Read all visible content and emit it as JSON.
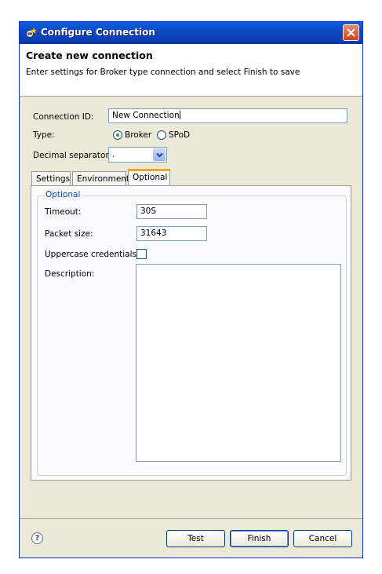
{
  "window": {
    "title": "Configure Connection"
  },
  "header": {
    "title": "Create new connection",
    "description": "Enter settings for Broker type connection and select Finish to save"
  },
  "form": {
    "connection_id_label": "Connection ID:",
    "connection_id_value": "New Connection",
    "type_label": "Type:",
    "type_options": [
      {
        "label": "Broker",
        "selected": true
      },
      {
        "label": "SPoD",
        "selected": false
      }
    ],
    "decimal_label": "Decimal separator:",
    "decimal_value": "."
  },
  "tabs": [
    {
      "label": "Settings",
      "active": false
    },
    {
      "label": "Environment",
      "active": false
    },
    {
      "label": "Optional",
      "active": true
    }
  ],
  "optional": {
    "group_title": "Optional",
    "timeout_label": "Timeout:",
    "timeout_value": "30S",
    "packet_size_label": "Packet size:",
    "packet_size_value": "31643",
    "uppercase_label": "Uppercase credentials:",
    "uppercase_checked": false,
    "description_label": "Description:",
    "description_value": ""
  },
  "footer": {
    "help_icon": "question-mark-circle-icon",
    "test_label": "Test",
    "finish_label": "Finish",
    "cancel_label": "Cancel"
  }
}
